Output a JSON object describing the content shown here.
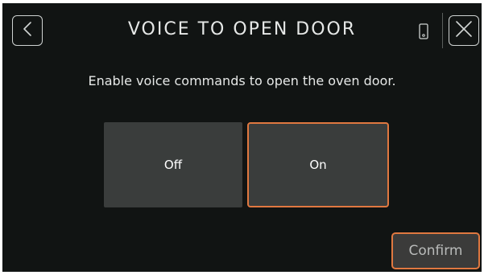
{
  "header": {
    "title": "VOICE TO OPEN DOOR",
    "back_icon": "chevron-left-icon",
    "phone_icon": "phone-icon",
    "close_icon": "close-icon"
  },
  "main": {
    "description": "Enable voice commands to open the oven door.",
    "options": [
      {
        "label": "Off",
        "selected": false
      },
      {
        "label": "On",
        "selected": true
      }
    ]
  },
  "footer": {
    "confirm_label": "Confirm"
  },
  "colors": {
    "background": "#111413",
    "option_background": "#3a3d3c",
    "accent": "#e07840",
    "text": "#e6e8e7"
  }
}
